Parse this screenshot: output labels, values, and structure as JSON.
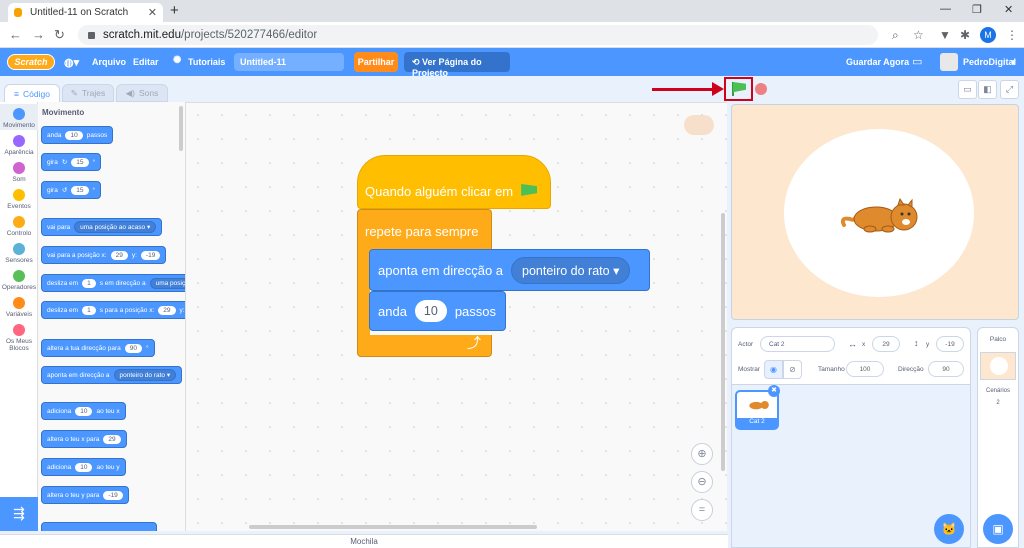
{
  "browser": {
    "tab_title": "Untitled-11 on Scratch",
    "url_host": "scratch.mit.edu",
    "url_path": "/projects/520277466/editor",
    "profile_initial": "M"
  },
  "menubar": {
    "logo": "Scratch",
    "file": "Arquivo",
    "edit": "Editar",
    "tutorials": "Tutoriais",
    "project_title": "Untitled-11",
    "share": "Partilhar",
    "see_project": "Ver Página do Projecto",
    "save_now": "Guardar Agora",
    "username": "PedroDigital"
  },
  "editor_tabs": [
    "Código",
    "Trajes",
    "Sons"
  ],
  "categories": [
    {
      "label": "Movimento",
      "color": "#4c97ff"
    },
    {
      "label": "Aparência",
      "color": "#9966ff"
    },
    {
      "label": "Som",
      "color": "#cf63cf"
    },
    {
      "label": "Eventos",
      "color": "#ffbf00"
    },
    {
      "label": "Controlo",
      "color": "#ffab19"
    },
    {
      "label": "Sensores",
      "color": "#5cb1d6"
    },
    {
      "label": "Operadores",
      "color": "#59c059"
    },
    {
      "label": "Variáveis",
      "color": "#ff8c1a"
    },
    {
      "label": "Os Meus Blocos",
      "color": "#ff6680"
    }
  ],
  "palette": {
    "title": "Movimento",
    "move_a": "anda",
    "move_n": "10",
    "move_b": "passos",
    "turn_r_a": "gira",
    "turn_r_n": "15",
    "turn_r_b": "°",
    "turn_l_a": "gira",
    "turn_l_n": "15",
    "turn_l_b": "°",
    "goto_a": "vai para",
    "goto_dd": "uma posição ao acaso",
    "gotoxy_a": "vai para a posição x:",
    "gotoxy_x": "29",
    "gotoxy_b": "y:",
    "gotoxy_y": "-19",
    "glide1_a": "desliza em",
    "glide1_n": "1",
    "glide1_b": "s em direcção a",
    "glide1_dd": "uma posição",
    "glide2_a": "desliza em",
    "glide2_n": "1",
    "glide2_b": "s para a posição x:",
    "glide2_x": "29",
    "glide2_c": "y:",
    "pointdir_a": "altera a tua direcção para",
    "pointdir_n": "90",
    "pointdir_b": "°",
    "pointto_a": "aponta em direcção a",
    "pointto_dd": "ponteiro do rato",
    "changex_a": "adiciona",
    "changex_n": "10",
    "changex_b": "ao teu x",
    "setx_a": "altera o teu x para",
    "setx_n": "29",
    "changey_a": "adiciona",
    "changey_n": "10",
    "changey_b": "ao teu y",
    "sety_a": "altera o teu y para",
    "sety_n": "-19"
  },
  "script": {
    "hat": "Quando alguém clicar em",
    "repeat": "repete para sempre",
    "point_to": "aponta em direcção a",
    "point_to_dd": "ponteiro do rato",
    "move": "anda",
    "move_n": "10",
    "move_steps": "passos"
  },
  "backpack": "Mochila",
  "sprite_info": {
    "sprite_label": "Actor",
    "sprite_name": "Cat 2",
    "x_label": "x",
    "x": "29",
    "y_label": "y",
    "y": "-19",
    "show_label": "Mostrar",
    "size_label": "Tamanho",
    "size": "100",
    "direction_label": "Direcção",
    "direction": "90"
  },
  "sprite_list": [
    {
      "name": "Cat 2"
    }
  ],
  "stage_panel": {
    "title": "Palco",
    "backdrops_label": "Cenários",
    "backdrops_count": "2"
  }
}
